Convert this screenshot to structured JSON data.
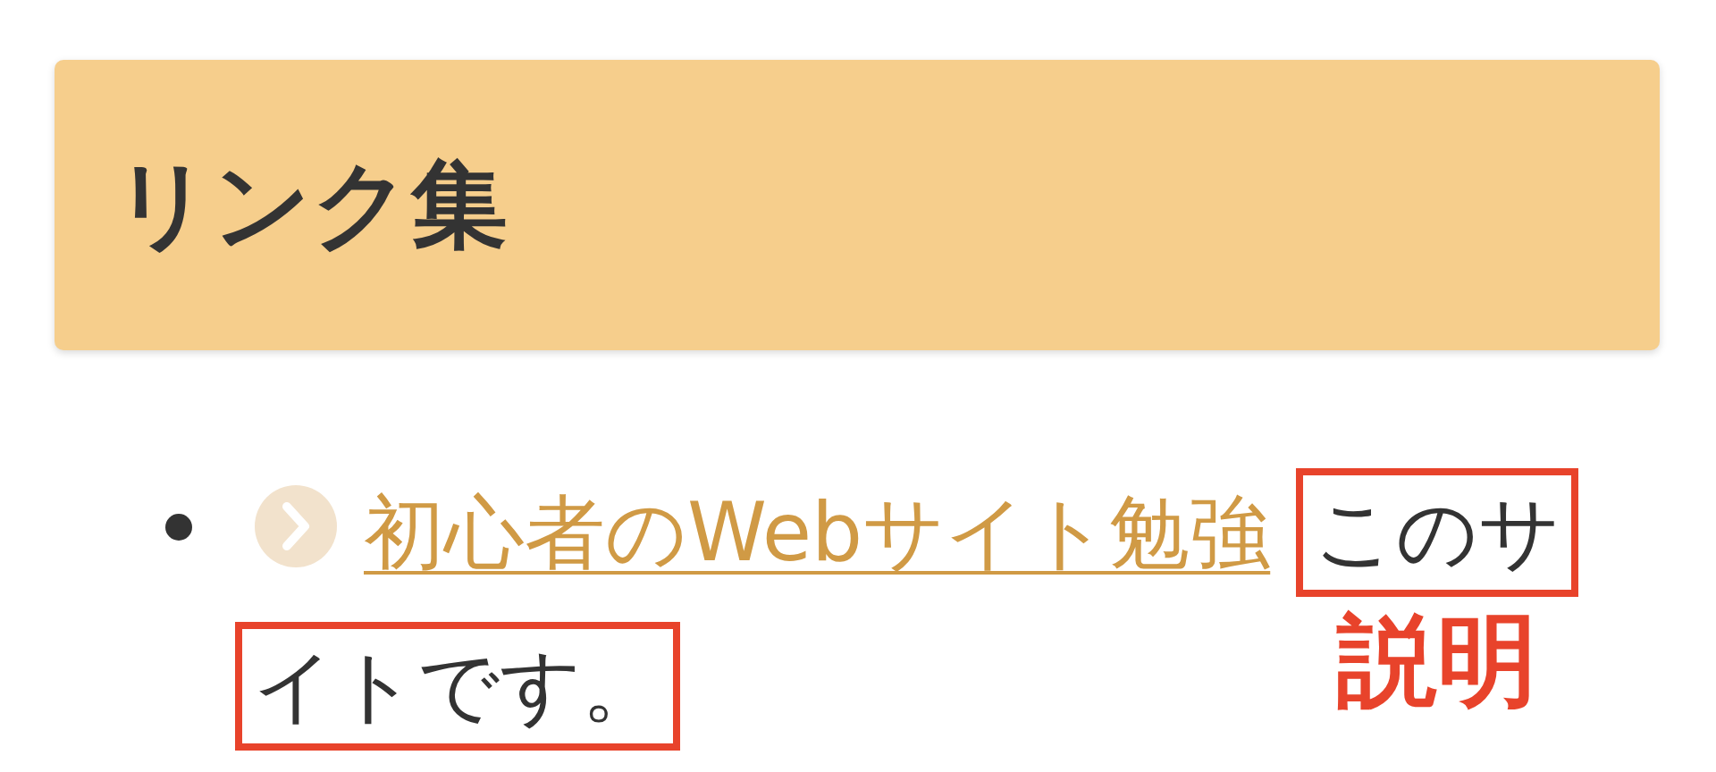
{
  "heading": {
    "title": "リンク集"
  },
  "links": [
    {
      "label": "初心者のWebサイト勉強",
      "description_lines": [
        "このサ",
        "イトです。"
      ],
      "annotation": "説明"
    }
  ]
}
